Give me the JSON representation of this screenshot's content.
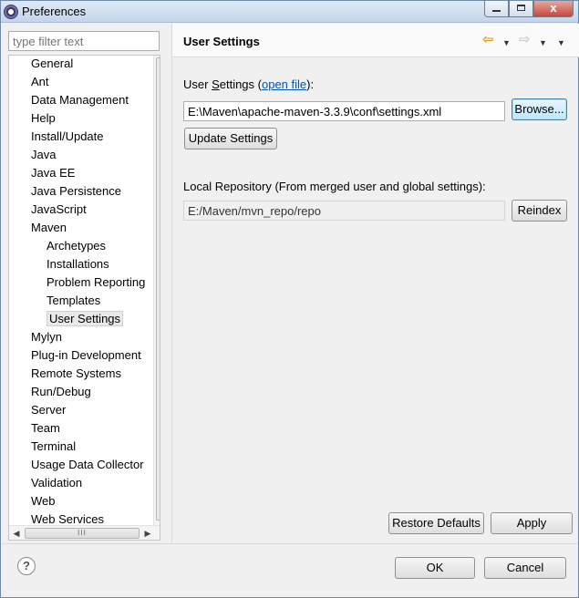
{
  "window": {
    "title": "Preferences",
    "minimize_label": "",
    "maximize_label": "",
    "close_label": "x"
  },
  "filter": {
    "placeholder": "type filter text",
    "value": ""
  },
  "tree": {
    "items": [
      {
        "label": "General",
        "level": 0
      },
      {
        "label": "Ant",
        "level": 0
      },
      {
        "label": "Data Management",
        "level": 0
      },
      {
        "label": "Help",
        "level": 0
      },
      {
        "label": "Install/Update",
        "level": 0
      },
      {
        "label": "Java",
        "level": 0
      },
      {
        "label": "Java EE",
        "level": 0
      },
      {
        "label": "Java Persistence",
        "level": 0
      },
      {
        "label": "JavaScript",
        "level": 0
      },
      {
        "label": "Maven",
        "level": 0
      },
      {
        "label": "Archetypes",
        "level": 1
      },
      {
        "label": "Installations",
        "level": 1
      },
      {
        "label": "Problem Reporting",
        "level": 1
      },
      {
        "label": "Templates",
        "level": 1
      },
      {
        "label": "User Settings",
        "level": 1,
        "selected": true
      },
      {
        "label": "Mylyn",
        "level": 0
      },
      {
        "label": "Plug-in Development",
        "level": 0
      },
      {
        "label": "Remote Systems",
        "level": 0
      },
      {
        "label": "Run/Debug",
        "level": 0
      },
      {
        "label": "Server",
        "level": 0
      },
      {
        "label": "Team",
        "level": 0
      },
      {
        "label": "Terminal",
        "level": 0
      },
      {
        "label": "Usage Data Collector",
        "level": 0
      },
      {
        "label": "Validation",
        "level": 0
      },
      {
        "label": "Web",
        "level": 0
      },
      {
        "label": "Web Services",
        "level": 0
      }
    ],
    "hscroll_grip": "III"
  },
  "page": {
    "title": "User Settings",
    "user_settings_label_prefix": "User ",
    "user_settings_label_underlined": "S",
    "user_settings_label_rest": "ettings (",
    "open_file_link": "open file",
    "user_settings_label_suffix": "):",
    "settings_path": "E:\\Maven\\apache-maven-3.3.9\\conf\\settings.xml",
    "browse_button": "Browse...",
    "update_settings_button": "Update Settings",
    "local_repo_label": "Local Repository (From merged user and global settings):",
    "local_repo_path": "E:/Maven/mvn_repo/repo",
    "reindex_button": "Reindex",
    "restore_defaults_button": "Restore Defaults",
    "apply_button": "Apply"
  },
  "footer": {
    "help_icon": "?",
    "ok_button": "OK",
    "cancel_button": "Cancel"
  }
}
